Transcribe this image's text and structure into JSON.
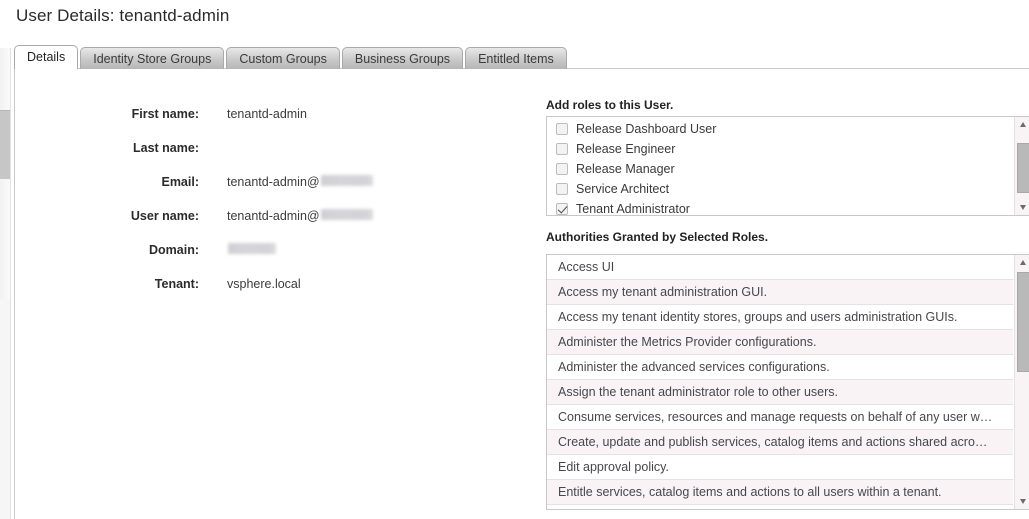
{
  "page": {
    "title": "User Details: tenantd-admin"
  },
  "tabs": [
    {
      "label": "Details",
      "active": true
    },
    {
      "label": "Identity Store Groups",
      "active": false
    },
    {
      "label": "Custom Groups",
      "active": false
    },
    {
      "label": "Business Groups",
      "active": false
    },
    {
      "label": "Entitled Items",
      "active": false
    }
  ],
  "details": {
    "fields": [
      {
        "label": "First name:",
        "value": "tenantd-admin",
        "redacted": false
      },
      {
        "label": "Last name:",
        "value": "",
        "redacted": false
      },
      {
        "label": "Email:",
        "value": "tenantd-admin@",
        "redacted": true,
        "redaction": "email"
      },
      {
        "label": "User name:",
        "value": "tenantd-admin@",
        "redacted": true,
        "redaction": "email"
      },
      {
        "label": "Domain:",
        "value": "",
        "redacted": true,
        "redaction": "domain"
      },
      {
        "label": "Tenant:",
        "value": "vsphere.local",
        "redacted": false
      }
    ]
  },
  "roles": {
    "section_label": "Add roles to this User.",
    "items": [
      {
        "label": "Release Dashboard User",
        "checked": false
      },
      {
        "label": "Release Engineer",
        "checked": false
      },
      {
        "label": "Release Manager",
        "checked": false
      },
      {
        "label": "Service Architect",
        "checked": false
      },
      {
        "label": "Tenant Administrator",
        "checked": true
      }
    ]
  },
  "authorities": {
    "section_label": "Authorities Granted by Selected Roles.",
    "items": [
      "Access UI",
      "Access my tenant administration GUI.",
      "Access my tenant identity stores, groups and users administration GUIs.",
      "Administer the Metrics Provider configurations.",
      "Administer the advanced services configurations.",
      "Assign the tenant administrator role to other users.",
      "Consume services, resources and manage requests on behalf of any user w…",
      "Create, update and publish services, catalog items and actions shared acro…",
      "Edit approval policy.",
      "Entitle services, catalog items and actions to all users within a tenant."
    ]
  },
  "icons": {
    "scroll_up": "scroll-up-arrow-icon",
    "scroll_down": "scroll-down-arrow-icon",
    "checkbox": "checkbox-icon"
  },
  "colors": {
    "panel_border": "#c9c9c9",
    "row_stripe": "#f9f3f6",
    "tab_active_bg": "#ffffff"
  }
}
